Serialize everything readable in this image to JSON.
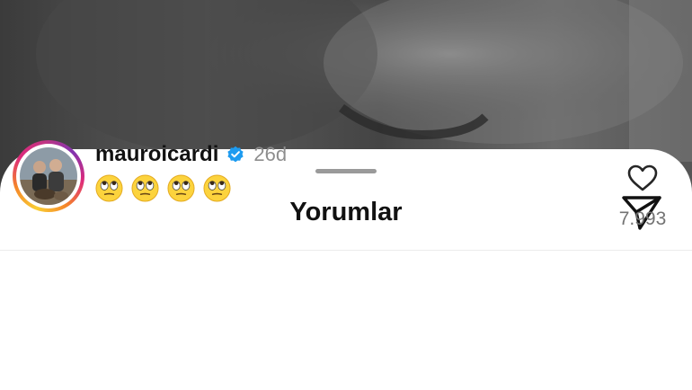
{
  "sheet": {
    "title": "Yorumlar",
    "share_icon": "send-icon"
  },
  "comment": {
    "username": "mauroicardi",
    "verified_icon": "verified-badge-icon",
    "time_ago": "26d",
    "emojis": [
      "face-with-rolling-eyes",
      "face-with-rolling-eyes",
      "face-with-rolling-eyes",
      "face-with-rolling-eyes"
    ],
    "like_icon": "heart-outline-icon",
    "like_count": "7.993"
  },
  "colors": {
    "sheet_background": "#ffffff",
    "verified_blue": "#1d9bf0",
    "muted_text": "#8e8e8e",
    "story_ring": [
      "#f9ce34",
      "#ee2a7b",
      "#6228d7"
    ]
  }
}
